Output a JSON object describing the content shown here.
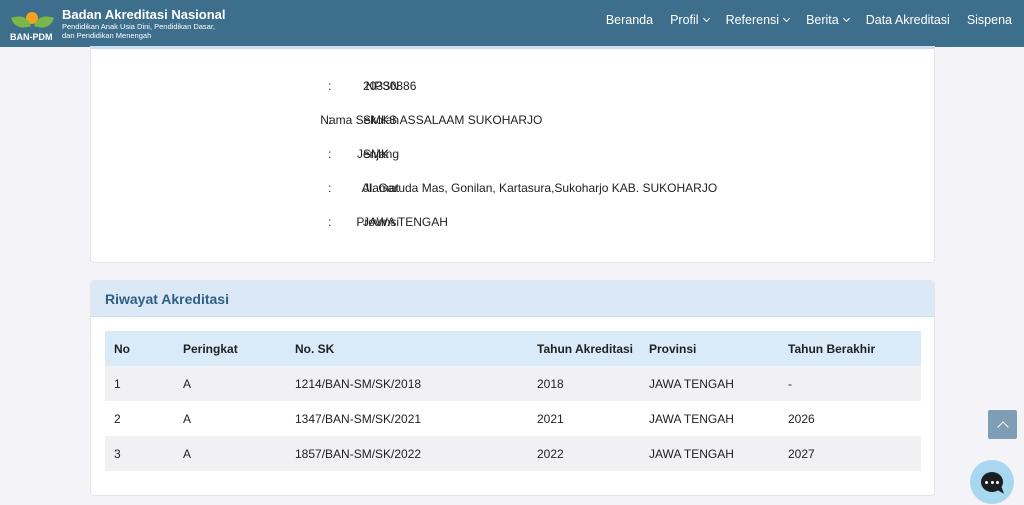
{
  "brand": {
    "logo_text": "BAN-PDM",
    "title": "Badan Akreditasi Nasional",
    "subtitle_line1": "Pendidikan Anak Usia Dini, Pendidikan Dasar,",
    "subtitle_line2": "dan Pendidikan Menengah"
  },
  "nav": {
    "items": [
      {
        "label": "Beranda",
        "dropdown": false
      },
      {
        "label": "Profil",
        "dropdown": true
      },
      {
        "label": "Referensi",
        "dropdown": true
      },
      {
        "label": "Berita",
        "dropdown": true
      },
      {
        "label": "Data Akreditasi",
        "dropdown": false
      },
      {
        "label": "Sispena",
        "dropdown": false
      }
    ]
  },
  "school": {
    "separator": ":",
    "rows": [
      {
        "label": "NPSN",
        "value": "20330886"
      },
      {
        "label": "Nama Sekolah",
        "value": "SMKS ASSALAAM SUKOHARJO"
      },
      {
        "label": "Jenjang",
        "value": "SMK"
      },
      {
        "label": "Alamat",
        "value": "Jl. Garuda Mas, Gonilan, Kartasura,Sukoharjo KAB. SUKOHARJO"
      },
      {
        "label": "Provinsi",
        "value": "JAWA TENGAH"
      }
    ]
  },
  "history": {
    "title": "Riwayat Akreditasi",
    "columns": [
      "No",
      "Peringkat",
      "No. SK",
      "Tahun Akreditasi",
      "Provinsi",
      "Tahun Berakhir"
    ],
    "rows": [
      [
        "1",
        "A",
        "1214/BAN-SM/SK/2018",
        "2018",
        "JAWA TENGAH",
        "-"
      ],
      [
        "2",
        "A",
        "1347/BAN-SM/SK/2021",
        "2021",
        "JAWA TENGAH",
        "2026"
      ],
      [
        "3",
        "A",
        "1857/BAN-SM/SK/2022",
        "2022",
        "JAWA TENGAH",
        "2027"
      ]
    ]
  },
  "floating": {
    "scroll_top_icon": "chevron-up-icon",
    "chat_icon": "chat-bubble-icon"
  },
  "colors": {
    "navbar": "#3d6f8c",
    "card_header": "#dbe9f6",
    "title_blue": "#2e5f86"
  }
}
